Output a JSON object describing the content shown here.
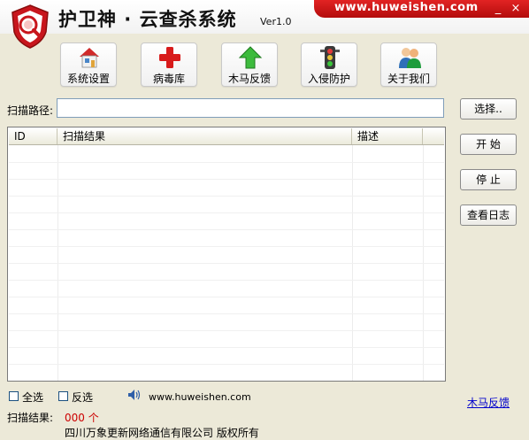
{
  "app": {
    "title": "护卫神 · 云查杀系统",
    "version": "Ver1.0",
    "site_url": "www.huweishen.com"
  },
  "window": {
    "minimize_glyph": "_",
    "close_glyph": "×"
  },
  "toolbar": [
    {
      "label": "系统设置",
      "icon": "house-settings-icon"
    },
    {
      "label": "病毒库",
      "icon": "red-cross-icon"
    },
    {
      "label": "木马反馈",
      "icon": "green-up-arrow-icon"
    },
    {
      "label": "入侵防护",
      "icon": "traffic-light-icon"
    },
    {
      "label": "关于我们",
      "icon": "users-icon"
    }
  ],
  "scan": {
    "path_label": "扫描路径:",
    "path_value": "",
    "browse_label": "选择..",
    "start_label": "开 始",
    "stop_label": "停 止",
    "log_label": "查看日志"
  },
  "table": {
    "columns": [
      "ID",
      "扫描结果",
      "描述"
    ],
    "rows": []
  },
  "footer": {
    "select_all": "全选",
    "invert_select": "反选",
    "url": "www.huweishen.com",
    "report_link": "木马反馈",
    "result_label": "扫描结果:",
    "result_count": "000 个",
    "copyright": "四川万象更新网络通信有限公司 版权所有"
  },
  "colors": {
    "accent_red": "#c8161d",
    "background": "#ECE9D8",
    "link": "#0000cc"
  }
}
